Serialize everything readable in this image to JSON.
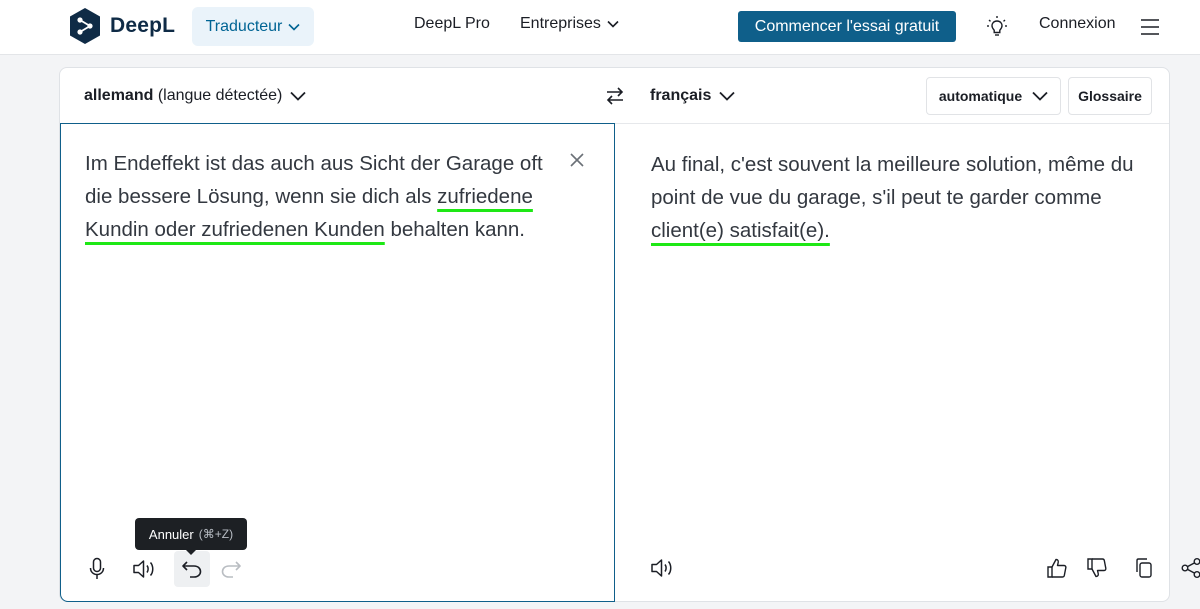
{
  "header": {
    "brand_name": "DeepL",
    "translator_label": "Traducteur",
    "pro_label": "DeepL Pro",
    "business_label": "Entreprises",
    "cta_label": "Commencer l'essai gratuit",
    "login_label": "Connexion"
  },
  "lang_bar": {
    "source_language": "allemand",
    "source_detected_note": "(langue détectée)",
    "target_language": "français",
    "formality": "automatique",
    "glossary_label": "Glossaire"
  },
  "source": {
    "text_before": "Im Endeffekt ist das auch aus Sicht der Garage oft die bessere Lösung, wenn sie dich als ",
    "text_highlight": "zufriedene Kundin oder zufriedenen Kunden",
    "text_after": " behalten kann."
  },
  "target": {
    "text_before": "Au final, c'est souvent la meilleure solution, même du point de vue du garage, s'il peut te garder comme ",
    "text_highlight": "client(e) satisfait(e)."
  },
  "tooltip": {
    "label": "Annuler",
    "shortcut": "(⌘+Z)"
  },
  "colors": {
    "brand": "#0f2b46",
    "accent": "#0f5f8a",
    "highlight_underline": "#1ee815"
  }
}
